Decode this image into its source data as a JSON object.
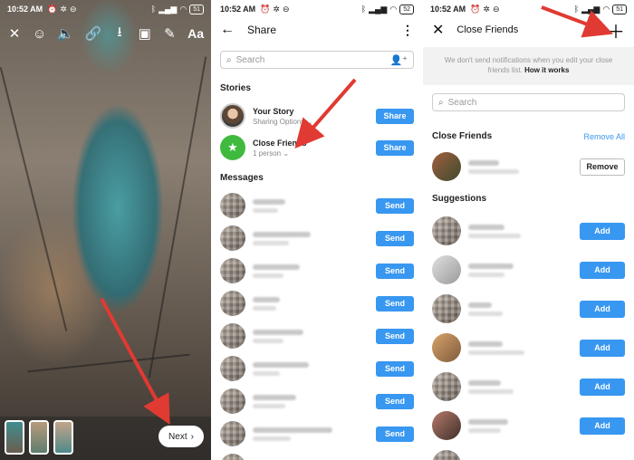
{
  "panel1": {
    "status": {
      "time": "10:52 AM",
      "battery": "51"
    },
    "toolbar": {
      "close": "✕",
      "face": "☺",
      "sound": "🔈",
      "link": "🔗",
      "download": "⭳",
      "sticker": "▣",
      "draw": "✎",
      "text": "Aa"
    },
    "next_label": "Next",
    "next_arrow": "›"
  },
  "panel2": {
    "status": {
      "time": "10:52 AM",
      "battery": "52"
    },
    "title": "Share",
    "search_placeholder": "Search",
    "stories_label": "Stories",
    "stories": [
      {
        "name": "Your Story",
        "sub": "Sharing Options ⌄",
        "button": "Share"
      },
      {
        "name": "Close Friends",
        "sub": "1 person ⌄",
        "button": "Share"
      }
    ],
    "messages_label": "Messages",
    "send_label": "Send"
  },
  "panel3": {
    "status": {
      "time": "10:52 AM",
      "battery": "51"
    },
    "title": "Close Friends",
    "notice": "We don't send notifications when you edit your close friends list.",
    "notice_link": "How it works",
    "search_placeholder": "Search",
    "close_friends_label": "Close Friends",
    "remove_all": "Remove All",
    "remove_label": "Remove",
    "suggestions_label": "Suggestions",
    "add_label": "Add"
  },
  "colors": {
    "accent": "#3897f0",
    "arrow": "#e03a32",
    "close_friends_green": "#3fba3f"
  }
}
